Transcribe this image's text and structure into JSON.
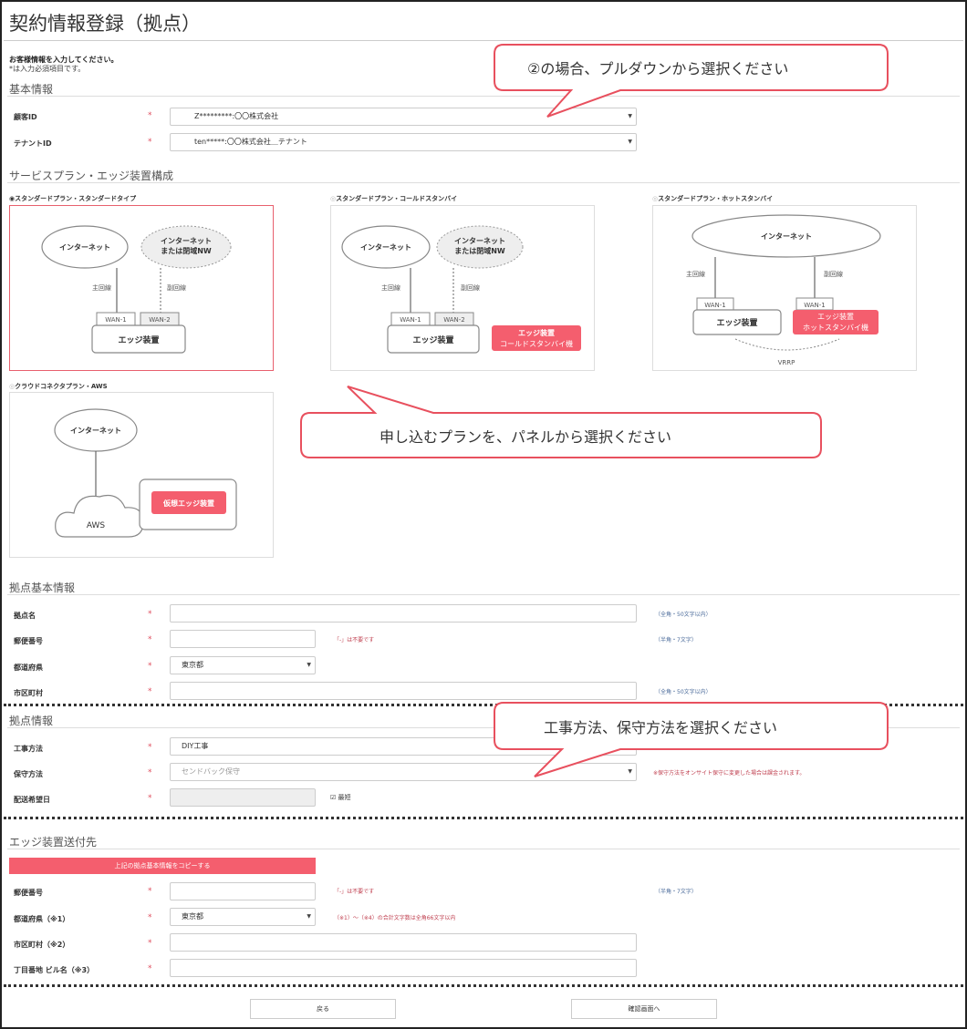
{
  "page_title": "契約情報登録（拠点）",
  "intro": {
    "line1": "お客様情報を入力してください。",
    "line2": "*は入力必須項目です。"
  },
  "required_mark": "*",
  "basic": {
    "title": "基本情報",
    "customer_id_label": "顧客ID",
    "customer_id_value": "Z*********:〇〇株式会社",
    "tenant_id_label": "テナントID",
    "tenant_id_value": "ten*****:〇〇株式会社＿テナント"
  },
  "plans": {
    "title": "サービスプラン・エッジ装置構成",
    "items": [
      {
        "label": "スタンダードプラン・スタンダードタイプ",
        "selected": true
      },
      {
        "label": "スタンダードプラン・コールドスタンバイ",
        "selected": false
      },
      {
        "label": "スタンダードプラン・ホットスタンバイ",
        "selected": false
      },
      {
        "label": "クラウドコネクタプラン・AWS",
        "selected": false
      }
    ],
    "diagram": {
      "internet": "インターネット",
      "internet_or_closed_1": "インターネット",
      "internet_or_closed_2": "または閉域NW",
      "main_line": "主回線",
      "sub_line": "副回線",
      "wan1": "WAN-1",
      "wan2": "WAN-2",
      "edge": "エッジ装置",
      "cold_1": "エッジ装置",
      "cold_2": "コールドスタンバイ機",
      "hot_1": "エッジ装置",
      "hot_2": "ホットスタンバイ機",
      "vrrp": "VRRP",
      "aws": "AWS",
      "virtual_edge": "仮想エッジ装置"
    }
  },
  "site_basic": {
    "title": "拠点基本情報",
    "site_name_label": "拠点名",
    "site_name_hint": "（全角・50文字以内）",
    "postal_label": "郵便番号",
    "postal_note": "「-」は不要です",
    "postal_hint": "（半角・7文字）",
    "pref_label": "都道府県",
    "pref_value": "東京都",
    "city_label": "市区町村",
    "city_hint": "（全角・50文字以内）"
  },
  "site_info": {
    "title": "拠点情報",
    "construction_label": "工事方法",
    "construction_value": "DIY工事",
    "maintenance_label": "保守方法",
    "maintenance_value": "センドバック保守",
    "maintenance_note": "※保守方法をオンサイト保守に変更した場合は課金されます。",
    "delivery_label": "配送希望日",
    "fastest_label": "最短",
    "fastest_checked": true
  },
  "shipping": {
    "title": "エッジ装置送付先",
    "copy_button": "上記の拠点基本情報をコピーする",
    "postal_label": "郵便番号",
    "postal_note": "「-」は不要です",
    "postal_hint": "（半角・7文字）",
    "pref_label": "都道府県（※1）",
    "pref_value": "東京都",
    "pref_note": "（※1）～（※4）の合計文字数は全角66文字以内",
    "city_label": "市区町村（※2）",
    "address_label": "丁目番地 ビル名（※3）"
  },
  "buttons": {
    "back": "戻る",
    "confirm": "確認画面へ"
  },
  "callouts": {
    "c1": "②の場合、プルダウンから選択ください",
    "c2": "申し込むプランを、パネルから選択ください",
    "c3": "工事方法、保守方法を選択ください"
  },
  "colors": {
    "accent": "#f45e6e",
    "callout_border": "#e8505e"
  }
}
